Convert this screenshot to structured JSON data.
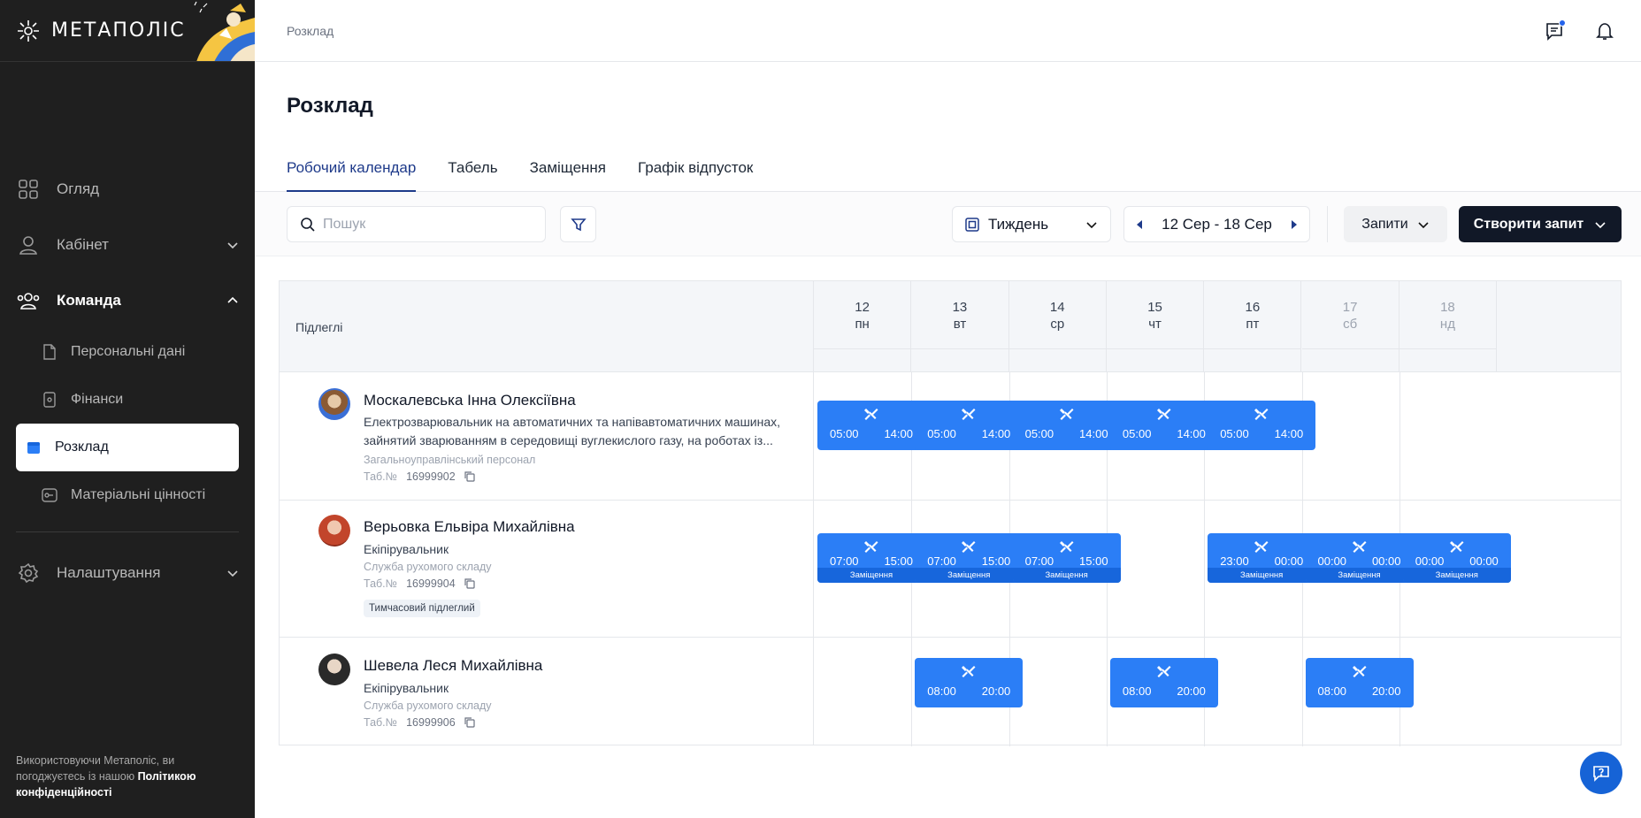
{
  "sidebar": {
    "logo_text": "МЕТАПОЛІС",
    "items": [
      {
        "label": "Огляд"
      },
      {
        "label": "Кабінет"
      },
      {
        "label": "Команда"
      },
      {
        "label": "Налаштування"
      }
    ],
    "sub_items": [
      {
        "label": "Персональні дані"
      },
      {
        "label": "Фінанси"
      },
      {
        "label": "Розклад"
      },
      {
        "label": "Матеріальні цінності"
      }
    ],
    "footer_text": "Використовуючи Метаполіс, ви погоджуєтесь із нашою",
    "footer_link": "Політикою конфіденційності"
  },
  "header": {
    "breadcrumb": "Розклад"
  },
  "page": {
    "title": "Розклад"
  },
  "tabs": [
    {
      "label": "Робочий календар"
    },
    {
      "label": "Табель"
    },
    {
      "label": "Заміщення"
    },
    {
      "label": "Графік відпусток"
    }
  ],
  "toolbar": {
    "search_placeholder": "Пошук",
    "period": "Тиждень",
    "range": "12 Сер - 18 Сер",
    "requests": "Запити",
    "create": "Створити запит"
  },
  "grid": {
    "first_col": "Підлеглі",
    "days": [
      {
        "num": "12",
        "dow": "пн"
      },
      {
        "num": "13",
        "dow": "вт"
      },
      {
        "num": "14",
        "dow": "ср"
      },
      {
        "num": "15",
        "dow": "чт"
      },
      {
        "num": "16",
        "dow": "пт"
      },
      {
        "num": "17",
        "dow": "сб"
      },
      {
        "num": "18",
        "dow": "нд"
      }
    ],
    "tab_label": "Таб.№",
    "employees": [
      {
        "name": "Москалевська Інна Олексіївна",
        "role": "Електрозварювальник на автоматичних та напівавтоматичних машинах, зайнятий зварюванням в середовищі вуглекислого газу, на роботах із...",
        "dept": "Загальноуправлінський персонал",
        "tab": "16999902"
      },
      {
        "name": "Верьовка Ельвіра Михайлівна",
        "role": "Екіпірувальник",
        "dept": "Служба рухомого складу",
        "tab": "16999904",
        "badge": "Тимчасовий підлеглий"
      },
      {
        "name": "Шевела Леся Михайлівна",
        "role": "Екіпірувальник",
        "dept": "Служба рухомого складу",
        "tab": "16999906"
      }
    ],
    "shift_sub": "Заміщення",
    "shifts": [
      [
        {
          "s": "05:00",
          "e": "14:00"
        },
        {
          "s": "05:00",
          "e": "14:00"
        },
        {
          "s": "05:00",
          "e": "14:00"
        },
        {
          "s": "05:00",
          "e": "14:00"
        },
        {
          "s": "05:00",
          "e": "14:00"
        }
      ],
      [
        {
          "s": "07:00",
          "e": "15:00"
        },
        {
          "s": "07:00",
          "e": "15:00"
        },
        {
          "s": "07:00",
          "e": "15:00"
        },
        {
          "s": "23:00",
          "e": "00:00"
        },
        {
          "s": "00:00",
          "e": "00:00"
        },
        {
          "s": "00:00",
          "e": "00:00"
        }
      ],
      [
        {
          "s": "08:00",
          "e": "20:00"
        },
        {
          "s": "08:00",
          "e": "20:00"
        },
        {
          "s": "08:00",
          "e": "20:00"
        }
      ]
    ]
  }
}
